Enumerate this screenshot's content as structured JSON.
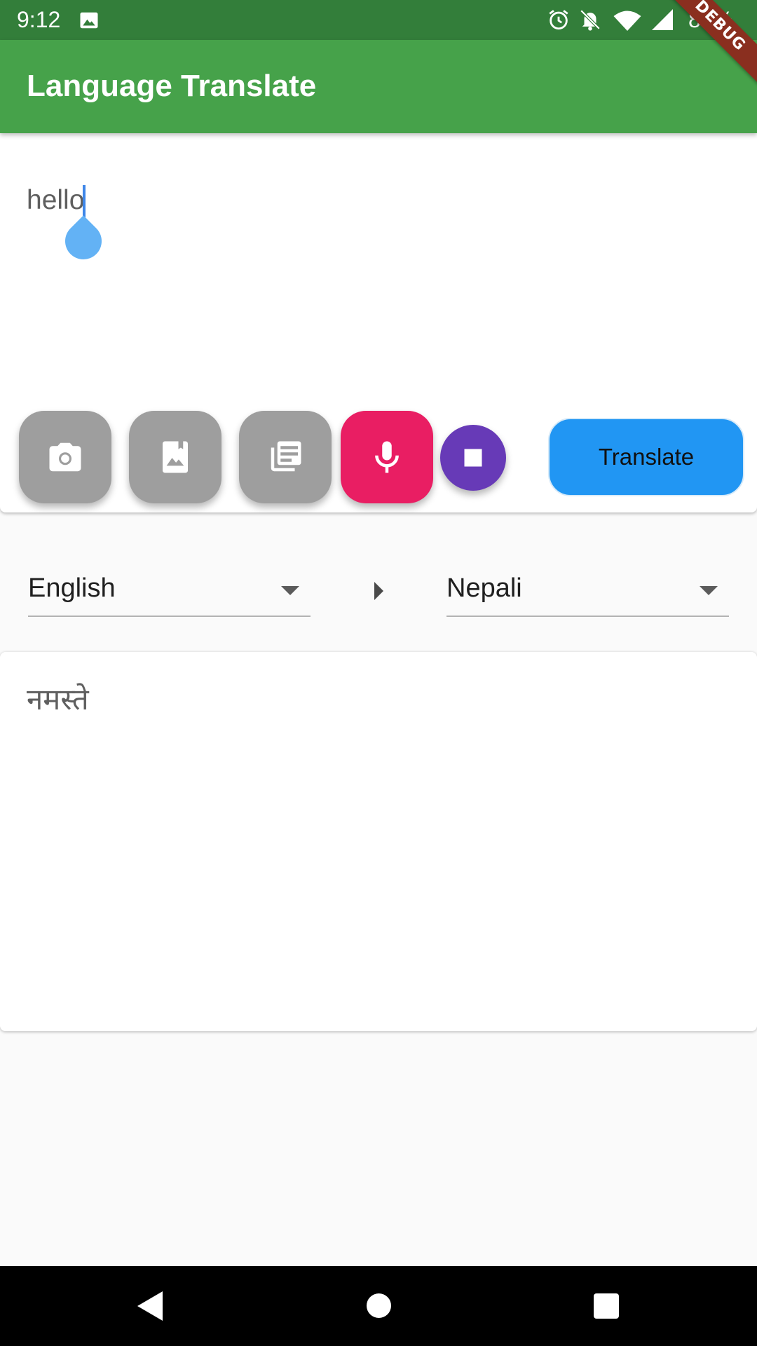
{
  "status_bar": {
    "time": "9:12",
    "battery": "81%",
    "icons": [
      "image-icon",
      "alarm-icon",
      "notifications-off-icon",
      "wifi-icon",
      "cellular-signal-icon"
    ]
  },
  "debug_banner": "DEBUG",
  "app_bar": {
    "title": "Language Translate",
    "color": "#46a24a"
  },
  "input": {
    "value": "hello"
  },
  "actions": {
    "camera_icon": "camera-icon",
    "gallery_icon": "image-icon",
    "document_icon": "document-icon",
    "mic_icon": "microphone-icon",
    "stop_icon": "stop-icon",
    "translate_label": "Translate"
  },
  "languages": {
    "source": "English",
    "target": "Nepali"
  },
  "output": {
    "value": "नमस्ते"
  },
  "nav_bar": {
    "icons": [
      "back-icon",
      "home-icon",
      "recents-icon"
    ]
  }
}
